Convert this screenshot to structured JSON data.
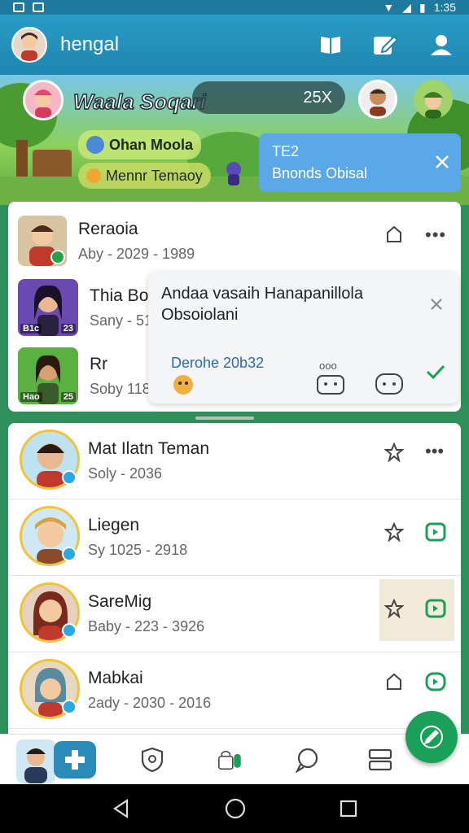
{
  "status_bar": {
    "time": "1:35"
  },
  "app_bar": {
    "title": "hengal"
  },
  "banner": {
    "username": "Waala Soqari",
    "progress": "25X",
    "pill1": "Ohan Moola",
    "pill2": "Mennr Temaoy",
    "toast_line1": "TE2",
    "toast_line2": "Bnonds Obisal"
  },
  "top_list": {
    "row1": {
      "name": "Reraoia",
      "sub": "Aby - 2029 - 1989"
    },
    "row2": {
      "name": "Thia Bo",
      "sub": "Sany - 51",
      "thumb_label_left": "B1c",
      "thumb_label_right": "23"
    },
    "row3": {
      "name": "Rr",
      "sub": "Soby 118",
      "thumb_label_left": "Hao",
      "thumb_label_right": "25"
    }
  },
  "popup": {
    "title": "Andaa vasaih Hanapanillola Obsoiolani",
    "link": "Derohe 20b32",
    "meta": "ooo"
  },
  "friend_list": [
    {
      "name": "Mat Ilatn Teman",
      "sub": "Soly - 2036"
    },
    {
      "name": "Liegen",
      "sub": "Sy 1025 - 2918"
    },
    {
      "name": "SareMig",
      "sub": "Baby - 223 - 3926"
    },
    {
      "name": "Mabkai",
      "sub": "2ady - 2030 - 2016"
    }
  ],
  "colors": {
    "app_bar": "#1d86b0",
    "accent_green": "#1aa058",
    "avatar_ring": "#f0c43a",
    "verify_blue": "#2aa8e0"
  }
}
